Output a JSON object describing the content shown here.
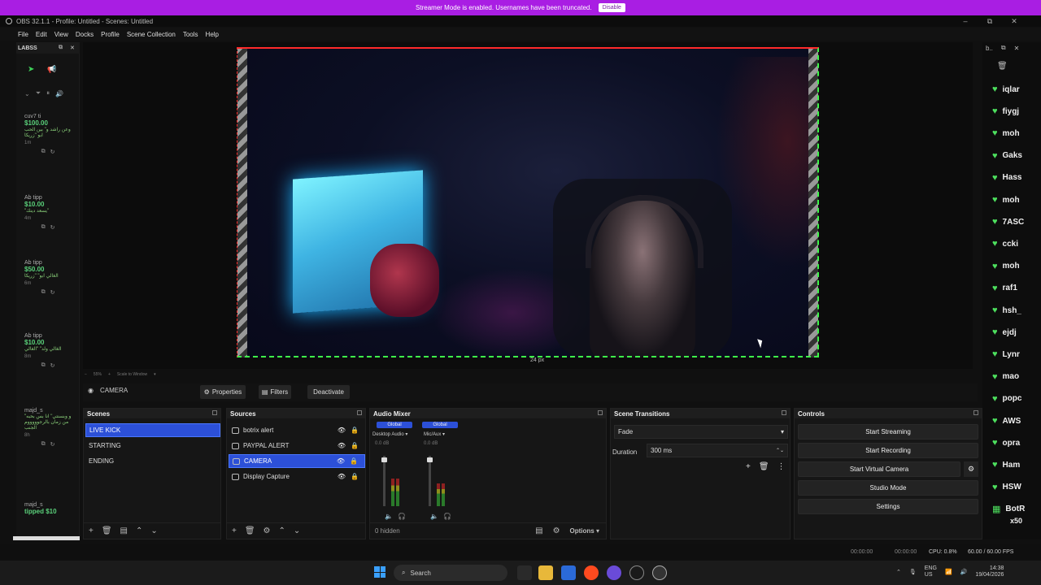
{
  "banner": {
    "text": "Streamer Mode is enabled. Usernames have been truncated.",
    "button": "Disable"
  },
  "window": {
    "title": "OBS 32.1.1 - Profile: Untitled - Scenes: Untitled",
    "minimize": "–",
    "maximize": "⧉",
    "close": "✕"
  },
  "menu": [
    "File",
    "Edit",
    "View",
    "Docks",
    "Profile",
    "Scene Collection",
    "Tools",
    "Help"
  ],
  "left_dock": {
    "title": "LABSS",
    "tips": [
      {
        "name": "cuv7 ti",
        "amount": "$100.00",
        "message": "وعن راشد و\" بين الحب ابو \"زريكا",
        "time": "1m"
      },
      {
        "name": "Ab tipp",
        "amount": "$10.00",
        "message": "\"يسعد دينك\"",
        "time": "4m"
      },
      {
        "name": "Ab tipp",
        "amount": "$50.00",
        "message": "الغالي ابو\" \"زريكا",
        "time": "6m"
      },
      {
        "name": "Ab tipp",
        "amount": "$10.00",
        "message": "الغالي ولد\" \"الغالي",
        "time": "8m"
      },
      {
        "name": "majd_s",
        "amount": "",
        "message": "\"و وبسنتي\" انا بس بحبه من زمان بالرجوووووم الجنب",
        "time": "8h"
      },
      {
        "name": "majd_s",
        "amount": "tipped $10",
        "message": "",
        "time": ""
      }
    ]
  },
  "preview": {
    "distance_label": "24 px",
    "zoom_text": "55%",
    "scale_text": "Scale to Window"
  },
  "source_toolbar": {
    "name": "CAMERA",
    "properties": "Properties",
    "filters": "Filters",
    "deactivate": "Deactivate"
  },
  "scenes": {
    "title": "Scenes",
    "items": [
      "LIVE KICK",
      "STARTING",
      "ENDING"
    ],
    "selected": "LIVE KICK"
  },
  "sources": {
    "title": "Sources",
    "items": [
      "botrix alert",
      "PAYPAL ALERT",
      "CAMERA",
      "Display Capture"
    ],
    "selected": "CAMERA"
  },
  "audio_mixer": {
    "title": "Audio Mixer",
    "channels": [
      {
        "badge": "Global",
        "name": "Desktop Audio",
        "db": "0.0 dB",
        "level": 0.55
      },
      {
        "badge": "Global",
        "name": "Mic/Aux",
        "db": "0.0 dB",
        "level": 0.45
      }
    ],
    "hidden": "0 hidden",
    "options": "Options"
  },
  "transitions": {
    "title": "Scene Transitions",
    "value": "Fade",
    "duration_label": "Duration",
    "duration_value": "300 ms"
  },
  "controls": {
    "title": "Controls",
    "buttons": [
      "Start Streaming",
      "Start Recording",
      "Start Virtual Camera",
      "Studio Mode",
      "Settings"
    ]
  },
  "status": {
    "stream_time": "00:00:00",
    "rec_time": "00:00:00",
    "cpu": "CPU: 0.8%",
    "fps": "60.00 / 60.00 FPS"
  },
  "taskbar": {
    "search": "Search",
    "lang": "ENG",
    "region": "US",
    "time": "14:38",
    "date": "19/04/2026"
  },
  "chat": {
    "names": [
      "iqlar",
      "fiygj",
      "moh",
      "Gaks",
      "Hass",
      "moh",
      "7ASC",
      "ccki",
      "moh",
      "raf1",
      "hsh_",
      "ejdj",
      "Lynr",
      "mao",
      "popc",
      "AWS",
      "opra",
      "Ham",
      "HSW",
      "BotR"
    ],
    "last_extra": "x50"
  },
  "colors": {
    "banner": "#a91ee3",
    "selection": "#2c50d8",
    "accent_green": "#4de05e"
  }
}
